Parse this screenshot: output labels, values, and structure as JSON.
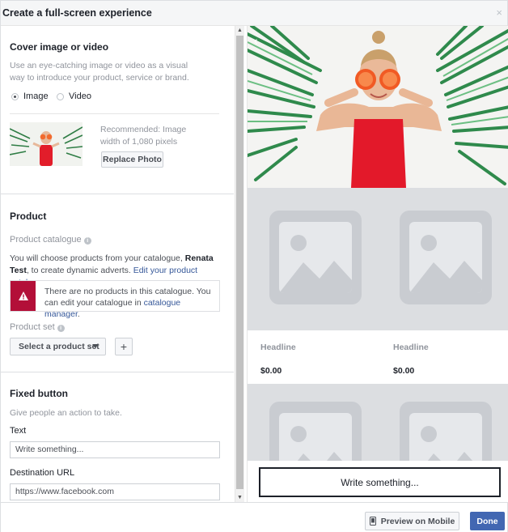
{
  "dialog": {
    "title": "Create a full-screen experience",
    "close_icon": "×"
  },
  "cover": {
    "title": "Cover image or video",
    "description": "Use an eye-catching image or video as a visual way to introduce your product, service or brand.",
    "options": [
      {
        "label": "Image",
        "selected": true
      },
      {
        "label": "Video",
        "selected": false
      }
    ],
    "recommendation": "Recommended: Image width of 1,080 pixels",
    "replace_label": "Replace Photo"
  },
  "product": {
    "title": "Product",
    "catalogue_label": "Product catalogue",
    "catalogue_text_pre": "You will choose products from your catalogue,",
    "catalogue_name": "Renata Test",
    "catalogue_text_post": ", to create dynamic adverts.",
    "edit_link": "Edit your product catalogue",
    "edit_link_suffix": ".",
    "warning_text": "There are no products in this catalogue. You can edit your catalogue in",
    "warning_link": "catalogue manager",
    "warning_suffix": ".",
    "set_label": "Product set",
    "select_label": "Select a product set",
    "add_label": "+"
  },
  "fixed_button": {
    "title": "Fixed button",
    "description": "Give people an action to take.",
    "text_label": "Text",
    "text_value": "Write something...",
    "url_label": "Destination URL",
    "url_value": "https://www.facebook.com"
  },
  "preview": {
    "headline_1": "Headline",
    "headline_2": "Headline",
    "price_1": "$0.00",
    "price_2": "$0.00",
    "cta_label": "Write something..."
  },
  "footer": {
    "preview_label": "Preview on Mobile",
    "done_label": "Done"
  },
  "colors": {
    "accent": "#4267b2",
    "warning": "#b30f38",
    "link": "#365899"
  }
}
